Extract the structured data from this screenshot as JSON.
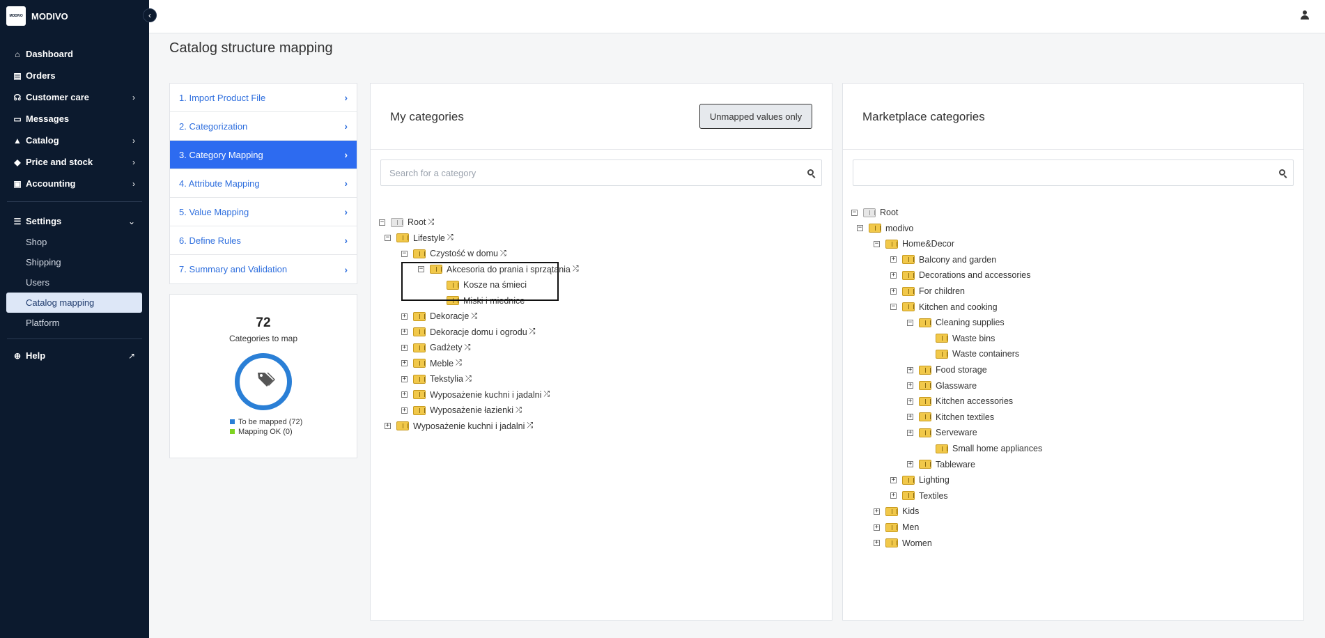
{
  "sidebar": {
    "brand": {
      "logo_text": "MODIVO",
      "name": "MODIVO"
    },
    "items": [
      {
        "label": "Dashboard",
        "icon": "home-icon"
      },
      {
        "label": "Orders",
        "icon": "clipboard-icon"
      },
      {
        "label": "Customer care",
        "icon": "headset-icon"
      },
      {
        "label": "Messages",
        "icon": "message-icon"
      },
      {
        "label": "Catalog",
        "icon": "shapes-icon"
      },
      {
        "label": "Price and stock",
        "icon": "tag-icon"
      },
      {
        "label": "Accounting",
        "icon": "calculator-icon"
      }
    ],
    "settings": {
      "label": "Settings",
      "subitems": [
        "Shop",
        "Shipping",
        "Users",
        "Catalog mapping",
        "Platform"
      ]
    },
    "help": "Help"
  },
  "page": {
    "title": "Catalog structure mapping"
  },
  "steps": [
    "1. Import Product File",
    "2. Categorization",
    "3. Category Mapping",
    "4. Attribute Mapping",
    "5. Value Mapping",
    "6. Define Rules",
    "7. Summary and Validation"
  ],
  "active_step": "3. Category Mapping",
  "stats": {
    "count": "72",
    "label": "Categories to map",
    "to_be_mapped": 72,
    "mapped_ok": 0,
    "legend_to_be_mapped": "To be mapped (72)",
    "legend_mapping_ok": "Mapping OK (0)",
    "color_to_be_mapped": "#2a7fd6",
    "color_mapping_ok": "#7ed321"
  },
  "my_categories": {
    "title": "My categories",
    "button": "Unmapped values only",
    "search_placeholder": "Search for a category",
    "tree": [
      {
        "label": "Root",
        "toggle": "minus",
        "root": true
      },
      {
        "label": "Lifestyle",
        "toggle": "minus"
      },
      {
        "label": "Czystość w domu",
        "toggle": "minus"
      },
      {
        "label": "Akcesoria do prania i sprzątania",
        "toggle": "minus"
      },
      {
        "label": "Kosze na śmieci",
        "toggle": "none"
      },
      {
        "label": "Miski i miednice",
        "toggle": "none"
      },
      {
        "label": "Dekoracje",
        "toggle": "plus"
      },
      {
        "label": "Dekoracje domu i ogrodu",
        "toggle": "plus"
      },
      {
        "label": "Gadżety",
        "toggle": "plus"
      },
      {
        "label": "Meble",
        "toggle": "plus"
      },
      {
        "label": "Tekstylia",
        "toggle": "plus"
      },
      {
        "label": "Wyposażenie kuchni i jadalni",
        "toggle": "plus"
      },
      {
        "label": "Wyposażenie łazienki",
        "toggle": "plus"
      },
      {
        "label": "Wyposażenie kuchni i jadalni",
        "toggle": "plus"
      }
    ]
  },
  "marketplace_categories": {
    "title": "Marketplace categories",
    "search_placeholder": "",
    "tree": [
      {
        "label": "Root",
        "toggle": "minus",
        "root": true
      },
      {
        "label": "modivo",
        "toggle": "minus"
      },
      {
        "label": "Home&Decor",
        "toggle": "minus"
      },
      {
        "label": "Balcony and garden",
        "toggle": "plus"
      },
      {
        "label": "Decorations and accessories",
        "toggle": "plus"
      },
      {
        "label": "For children",
        "toggle": "plus"
      },
      {
        "label": "Kitchen and cooking",
        "toggle": "minus"
      },
      {
        "label": "Cleaning supplies",
        "toggle": "minus"
      },
      {
        "label": "Waste bins",
        "toggle": "none"
      },
      {
        "label": "Waste containers",
        "toggle": "none"
      },
      {
        "label": "Food storage",
        "toggle": "plus"
      },
      {
        "label": "Glassware",
        "toggle": "plus"
      },
      {
        "label": "Kitchen accessories",
        "toggle": "plus"
      },
      {
        "label": "Kitchen textiles",
        "toggle": "plus"
      },
      {
        "label": "Serveware",
        "toggle": "plus"
      },
      {
        "label": "Small home appliances",
        "toggle": "none"
      },
      {
        "label": "Tableware",
        "toggle": "plus"
      },
      {
        "label": "Lighting",
        "toggle": "plus"
      },
      {
        "label": "Textiles",
        "toggle": "plus"
      },
      {
        "label": "Kids",
        "toggle": "plus"
      },
      {
        "label": "Men",
        "toggle": "plus"
      },
      {
        "label": "Women",
        "toggle": "plus"
      }
    ]
  }
}
